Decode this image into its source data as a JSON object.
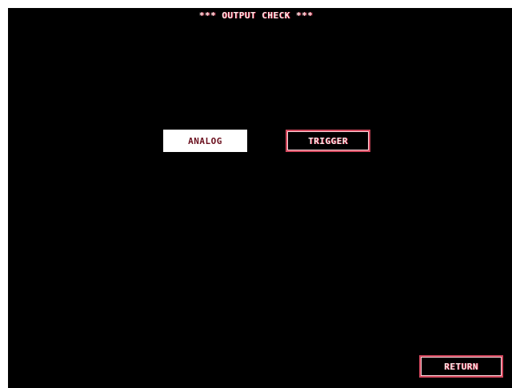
{
  "screen": {
    "title": "*** OUTPUT CHECK ***"
  },
  "buttons": {
    "analog_label": "ANALOG",
    "trigger_label": "TRIGGER",
    "return_label": "RETURN"
  },
  "state": {
    "selected": "ANALOG"
  },
  "colors": {
    "background": "#000000",
    "text": "#ffe8e8",
    "accent": "#d4485e",
    "selected_bg": "#ffffff",
    "selected_text": "#6a0f1d"
  }
}
